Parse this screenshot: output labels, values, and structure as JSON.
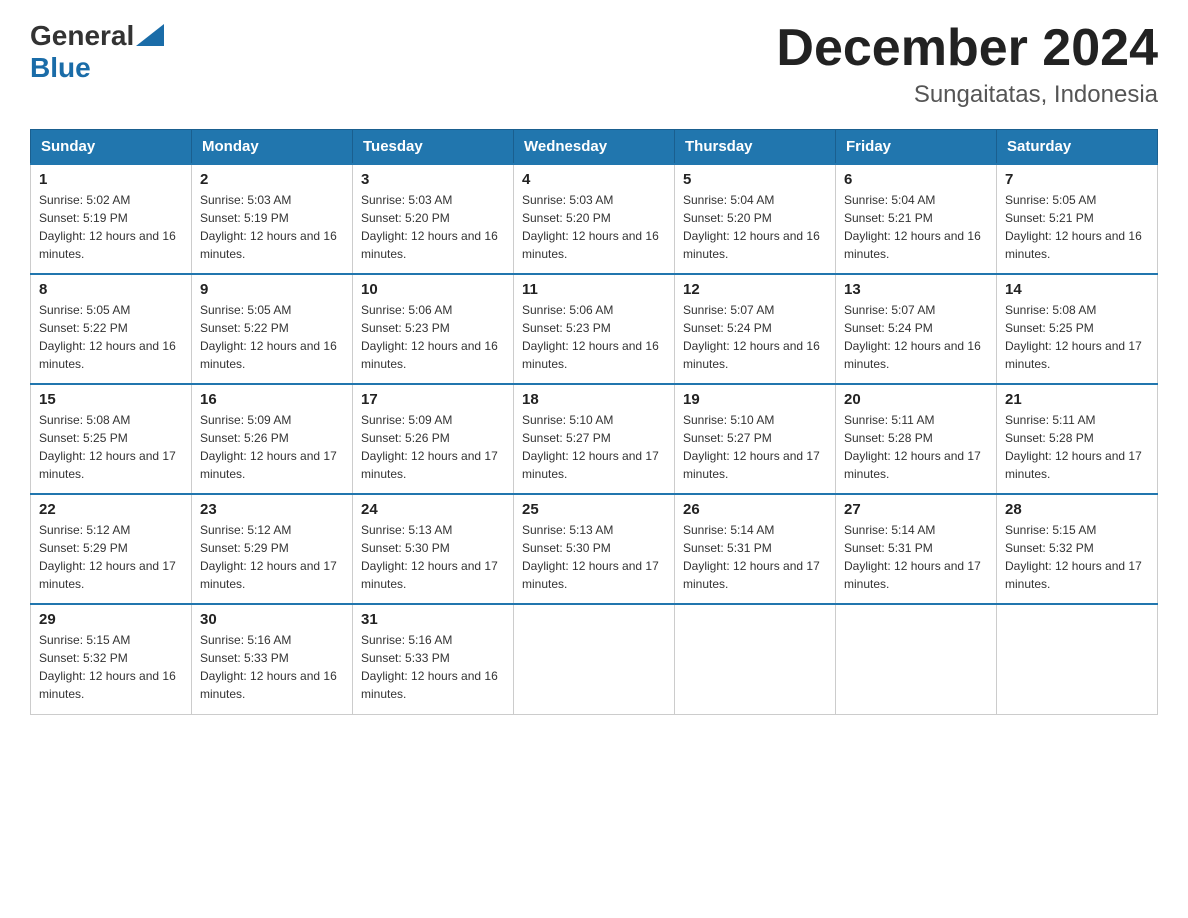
{
  "header": {
    "title": "December 2024",
    "subtitle": "Sungaitatas, Indonesia",
    "logo_general": "General",
    "logo_blue": "Blue"
  },
  "days_of_week": [
    "Sunday",
    "Monday",
    "Tuesday",
    "Wednesday",
    "Thursday",
    "Friday",
    "Saturday"
  ],
  "weeks": [
    [
      {
        "day": "1",
        "sunrise": "5:02 AM",
        "sunset": "5:19 PM",
        "daylight": "12 hours and 16 minutes."
      },
      {
        "day": "2",
        "sunrise": "5:03 AM",
        "sunset": "5:19 PM",
        "daylight": "12 hours and 16 minutes."
      },
      {
        "day": "3",
        "sunrise": "5:03 AM",
        "sunset": "5:20 PM",
        "daylight": "12 hours and 16 minutes."
      },
      {
        "day": "4",
        "sunrise": "5:03 AM",
        "sunset": "5:20 PM",
        "daylight": "12 hours and 16 minutes."
      },
      {
        "day": "5",
        "sunrise": "5:04 AM",
        "sunset": "5:20 PM",
        "daylight": "12 hours and 16 minutes."
      },
      {
        "day": "6",
        "sunrise": "5:04 AM",
        "sunset": "5:21 PM",
        "daylight": "12 hours and 16 minutes."
      },
      {
        "day": "7",
        "sunrise": "5:05 AM",
        "sunset": "5:21 PM",
        "daylight": "12 hours and 16 minutes."
      }
    ],
    [
      {
        "day": "8",
        "sunrise": "5:05 AM",
        "sunset": "5:22 PM",
        "daylight": "12 hours and 16 minutes."
      },
      {
        "day": "9",
        "sunrise": "5:05 AM",
        "sunset": "5:22 PM",
        "daylight": "12 hours and 16 minutes."
      },
      {
        "day": "10",
        "sunrise": "5:06 AM",
        "sunset": "5:23 PM",
        "daylight": "12 hours and 16 minutes."
      },
      {
        "day": "11",
        "sunrise": "5:06 AM",
        "sunset": "5:23 PM",
        "daylight": "12 hours and 16 minutes."
      },
      {
        "day": "12",
        "sunrise": "5:07 AM",
        "sunset": "5:24 PM",
        "daylight": "12 hours and 16 minutes."
      },
      {
        "day": "13",
        "sunrise": "5:07 AM",
        "sunset": "5:24 PM",
        "daylight": "12 hours and 16 minutes."
      },
      {
        "day": "14",
        "sunrise": "5:08 AM",
        "sunset": "5:25 PM",
        "daylight": "12 hours and 17 minutes."
      }
    ],
    [
      {
        "day": "15",
        "sunrise": "5:08 AM",
        "sunset": "5:25 PM",
        "daylight": "12 hours and 17 minutes."
      },
      {
        "day": "16",
        "sunrise": "5:09 AM",
        "sunset": "5:26 PM",
        "daylight": "12 hours and 17 minutes."
      },
      {
        "day": "17",
        "sunrise": "5:09 AM",
        "sunset": "5:26 PM",
        "daylight": "12 hours and 17 minutes."
      },
      {
        "day": "18",
        "sunrise": "5:10 AM",
        "sunset": "5:27 PM",
        "daylight": "12 hours and 17 minutes."
      },
      {
        "day": "19",
        "sunrise": "5:10 AM",
        "sunset": "5:27 PM",
        "daylight": "12 hours and 17 minutes."
      },
      {
        "day": "20",
        "sunrise": "5:11 AM",
        "sunset": "5:28 PM",
        "daylight": "12 hours and 17 minutes."
      },
      {
        "day": "21",
        "sunrise": "5:11 AM",
        "sunset": "5:28 PM",
        "daylight": "12 hours and 17 minutes."
      }
    ],
    [
      {
        "day": "22",
        "sunrise": "5:12 AM",
        "sunset": "5:29 PM",
        "daylight": "12 hours and 17 minutes."
      },
      {
        "day": "23",
        "sunrise": "5:12 AM",
        "sunset": "5:29 PM",
        "daylight": "12 hours and 17 minutes."
      },
      {
        "day": "24",
        "sunrise": "5:13 AM",
        "sunset": "5:30 PM",
        "daylight": "12 hours and 17 minutes."
      },
      {
        "day": "25",
        "sunrise": "5:13 AM",
        "sunset": "5:30 PM",
        "daylight": "12 hours and 17 minutes."
      },
      {
        "day": "26",
        "sunrise": "5:14 AM",
        "sunset": "5:31 PM",
        "daylight": "12 hours and 17 minutes."
      },
      {
        "day": "27",
        "sunrise": "5:14 AM",
        "sunset": "5:31 PM",
        "daylight": "12 hours and 17 minutes."
      },
      {
        "day": "28",
        "sunrise": "5:15 AM",
        "sunset": "5:32 PM",
        "daylight": "12 hours and 17 minutes."
      }
    ],
    [
      {
        "day": "29",
        "sunrise": "5:15 AM",
        "sunset": "5:32 PM",
        "daylight": "12 hours and 16 minutes."
      },
      {
        "day": "30",
        "sunrise": "5:16 AM",
        "sunset": "5:33 PM",
        "daylight": "12 hours and 16 minutes."
      },
      {
        "day": "31",
        "sunrise": "5:16 AM",
        "sunset": "5:33 PM",
        "daylight": "12 hours and 16 minutes."
      },
      null,
      null,
      null,
      null
    ]
  ]
}
